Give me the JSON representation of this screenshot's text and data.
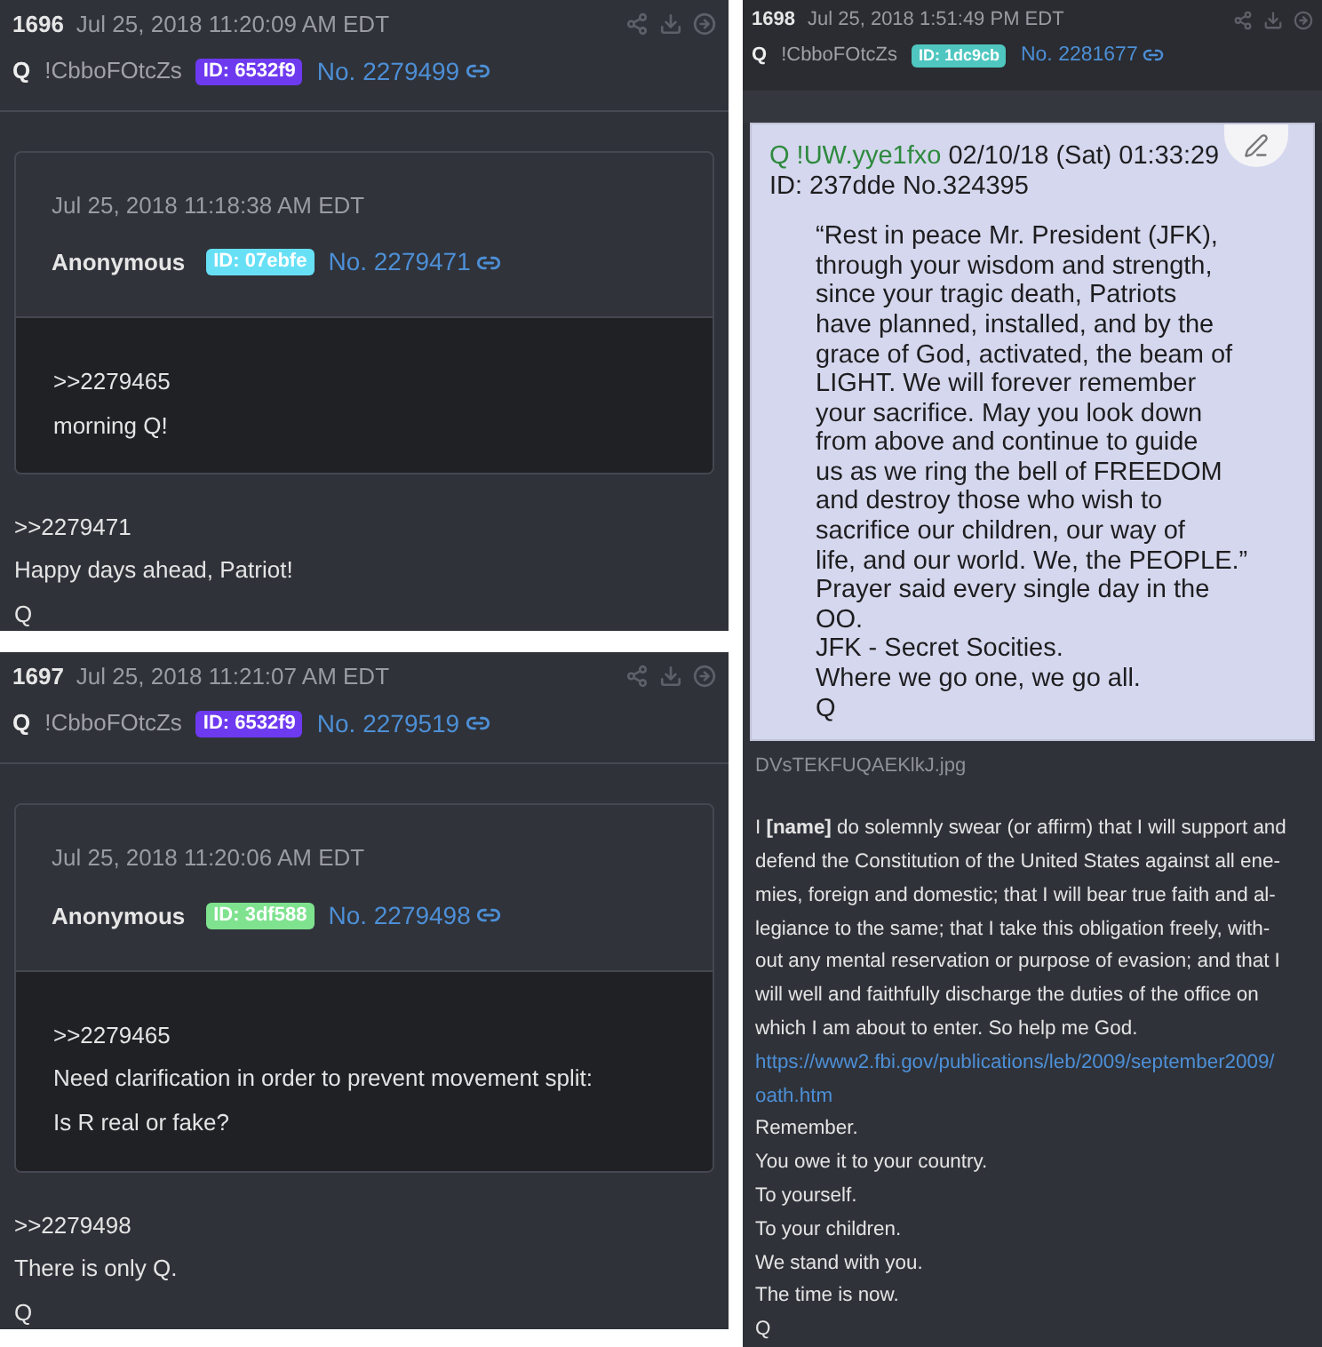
{
  "posts": [
    {
      "number": "1696",
      "date": "Jul 25, 2018 11:20:09 AM EDT",
      "name": "Q",
      "tripcode": "!CbboFOtcZs",
      "id_badge": {
        "label": "ID: 6532f9",
        "color": "#6e3af0"
      },
      "post_no": "No. 2279499",
      "quote": {
        "date": "Jul 25, 2018 11:18:38 AM EDT",
        "name": "Anonymous",
        "id_badge": {
          "label": "ID: 07ebfe",
          "color": "#67e0f6"
        },
        "post_no": "No. 2279471",
        "lines": [
          ">>2279465",
          "morning Q!"
        ]
      },
      "lines": [
        ">>2279471",
        "Happy days ahead, Patriot!",
        "Q"
      ]
    },
    {
      "number": "1697",
      "date": "Jul 25, 2018 11:21:07 AM EDT",
      "name": "Q",
      "tripcode": "!CbboFOtcZs",
      "id_badge": {
        "label": "ID: 6532f9",
        "color": "#6e3af0"
      },
      "post_no": "No. 2279519",
      "quote": {
        "date": "Jul 25, 2018 11:20:06 AM EDT",
        "name": "Anonymous",
        "id_badge": {
          "label": "ID: 3df588",
          "color": "#7fe28f"
        },
        "post_no": "No. 2279498",
        "lines": [
          ">>2279465",
          "Need clarification in order to prevent movement split:",
          "Is R real or fake?"
        ]
      },
      "lines": [
        ">>2279498",
        "There is only Q.",
        "Q"
      ]
    }
  ],
  "image_post": {
    "number": "1698",
    "date": "Jul 25, 2018 1:51:49 PM EDT",
    "name": "Q",
    "tripcode": "!CbboFOtcZs",
    "id_badge": {
      "label": "ID: 1dc9cb",
      "color": "#4fc6c0"
    },
    "post_no": "No. 2281677",
    "screenshot": {
      "header_name": "Q !UW.yye1fxo",
      "header_date": "02/10/18 (Sat) 01:33:29",
      "header_meta": "ID: 237dde No.324395",
      "quote_lines": [
        "“Rest in peace Mr. President (JFK),",
        "through your wisdom and strength,",
        "since your tragic death, Patriots",
        "have planned, installed, and by the",
        "grace of God, activated, the beam of",
        "LIGHT. We will forever remember",
        "your sacrifice. May you look down",
        "from above and continue to guide",
        "us as we ring the bell of FREEDOM",
        "and destroy those who wish to",
        "sacrifice our children, our way of",
        "life, and our world. We, the PEOPLE.”"
      ],
      "after_lines": [
        "Prayer said every single day in the",
        "OO.",
        "JFK - Secret Socities.",
        "Where we go one, we go all.",
        "Q"
      ]
    },
    "filename": "DVsTEKFUQAEKlkJ.jpg",
    "body": [
      {
        "kind": "paragraph",
        "lines": [
          "I **[name]** do solemnly swear (or affirm) that I will support and",
          "defend the Constitution of the United States against all ene-",
          "mies, foreign and domestic; that I will bear true faith and al-",
          "legiance to the same; that I take this obligation freely, with-",
          "out any mental reservation or purpose of evasion; and that I",
          "will well and faithfully discharge the duties of the office on",
          "which I am about to enter. So help me God."
        ]
      },
      {
        "kind": "link",
        "lines": [
          "https://www2.fbi.gov/publications/leb/2009/september2009/",
          "oath.htm"
        ]
      },
      {
        "kind": "text",
        "lines": [
          "Remember."
        ]
      },
      {
        "kind": "text",
        "lines": [
          "You owe it to your country."
        ]
      },
      {
        "kind": "text",
        "lines": [
          "To yourself."
        ]
      },
      {
        "kind": "text",
        "lines": [
          "To your children."
        ]
      },
      {
        "kind": "text",
        "lines": [
          "We stand with you."
        ]
      },
      {
        "kind": "text",
        "lines": [
          "The time is now."
        ]
      },
      {
        "kind": "text",
        "lines": [
          "Q"
        ]
      }
    ]
  }
}
